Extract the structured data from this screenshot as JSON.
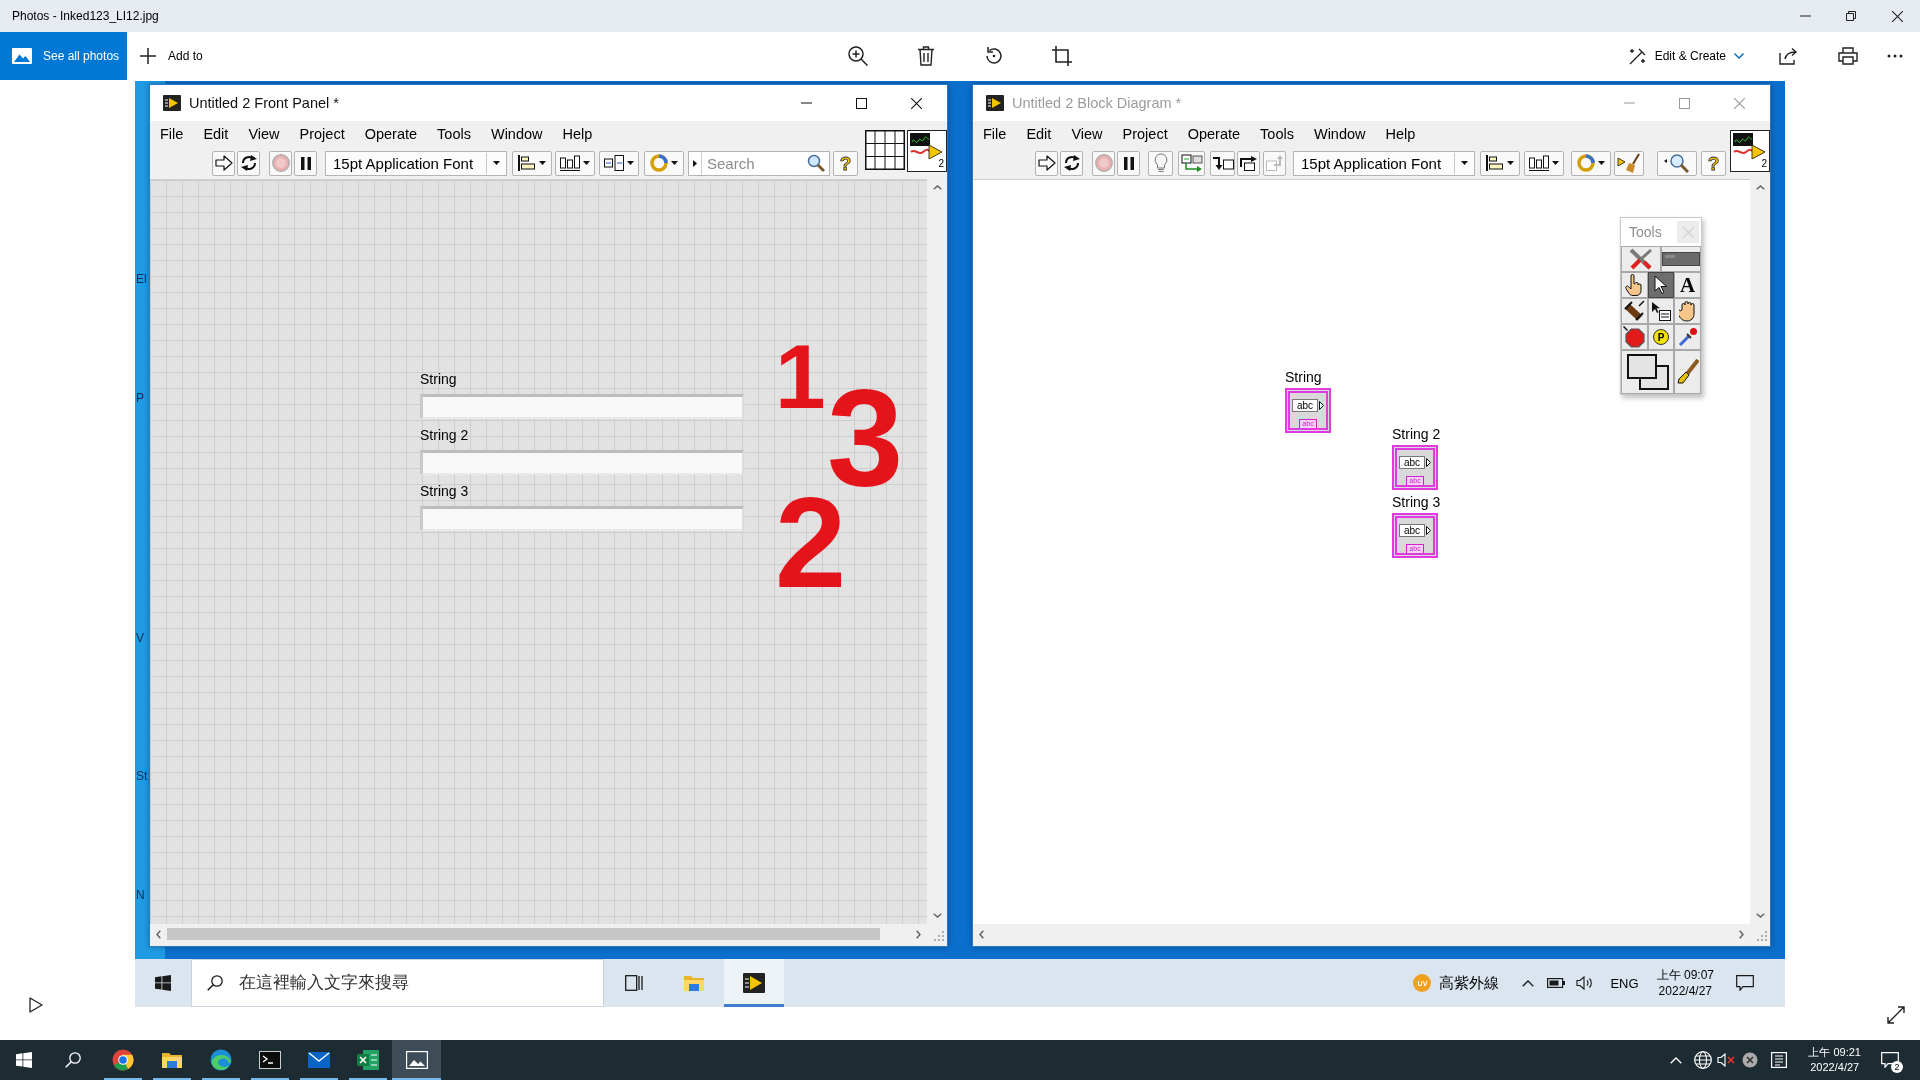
{
  "window": {
    "title": "Photos - Inked123_LI12.jpg"
  },
  "toolbar": {
    "see_all": "See all photos",
    "add_to": "Add to",
    "edit_create": "Edit & Create"
  },
  "photo": {
    "background_window": {
      "fragments": [
        "El",
        "P",
        "V",
        "St",
        "N"
      ]
    },
    "front_panel": {
      "title": "Untitled 2 Front Panel *",
      "active": true,
      "menu": [
        "File",
        "Edit",
        "View",
        "Project",
        "Operate",
        "Tools",
        "Window",
        "Help"
      ],
      "font": "15pt Application Font",
      "search": {
        "placeholder": "Search"
      },
      "help": "?",
      "vi_icon_number": "2",
      "controls": [
        {
          "label": "String"
        },
        {
          "label": "String 2"
        },
        {
          "label": "String 3"
        }
      ],
      "ink": [
        "1",
        "3",
        "2"
      ]
    },
    "block_diagram": {
      "title": "Untitled 2 Block Diagram *",
      "active": false,
      "menu": [
        "File",
        "Edit",
        "View",
        "Project",
        "Operate",
        "Tools",
        "Window",
        "Help"
      ],
      "font": "15pt Application Font",
      "help": "?",
      "vi_icon_number": "2",
      "tools_palette": {
        "title": "Tools",
        "auto_tool": {
          "on": false
        },
        "tools": [
          {
            "kind": "operate",
            "selected": false
          },
          {
            "kind": "position",
            "selected": true
          },
          {
            "kind": "text",
            "label": "A",
            "selected": false
          },
          {
            "kind": "wiring",
            "selected": false
          },
          {
            "kind": "shortcut-menu",
            "selected": false
          },
          {
            "kind": "scroll",
            "selected": false
          },
          {
            "kind": "breakpoint",
            "selected": false
          },
          {
            "kind": "probe",
            "label": "P",
            "selected": false
          },
          {
            "kind": "color-copy",
            "selected": false
          },
          {
            "kind": "coloring",
            "selected": false
          }
        ]
      },
      "nodes": [
        {
          "label": "String",
          "display": "abc",
          "type_text": "abc"
        },
        {
          "label": "String 2",
          "display": "abc",
          "type_text": "abc"
        },
        {
          "label": "String 3",
          "display": "abc",
          "type_text": "abc"
        }
      ]
    },
    "taskbar": {
      "search": {
        "placeholder": "在這裡輸入文字來搜尋"
      },
      "apps": [
        {
          "kind": "task-view",
          "selected": false
        },
        {
          "kind": "file-explorer",
          "selected": false
        },
        {
          "kind": "labview",
          "selected": true
        }
      ],
      "weather": {
        "badge": "UV",
        "text": "高紫外線"
      },
      "language": "ENG",
      "time": "上午 09:07",
      "date": "2022/4/27"
    }
  },
  "taskbar": {
    "apps": [
      {
        "kind": "chrome",
        "running": true,
        "selected": false
      },
      {
        "kind": "file-explorer",
        "running": true,
        "selected": false
      },
      {
        "kind": "edge",
        "running": true,
        "selected": false
      },
      {
        "kind": "terminal",
        "running": true,
        "selected": false
      },
      {
        "kind": "mail",
        "running": true,
        "selected": false
      },
      {
        "kind": "excel",
        "running": true,
        "selected": false
      },
      {
        "kind": "photos",
        "running": true,
        "selected": true
      }
    ],
    "time": "上午 09:21",
    "date": "2022/4/27",
    "notifications": "2"
  }
}
